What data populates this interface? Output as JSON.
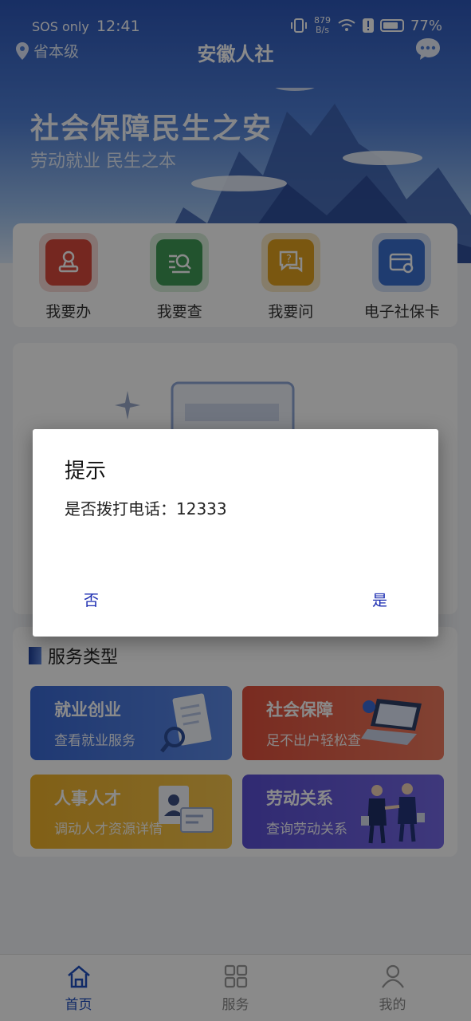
{
  "status_bar": {
    "carrier": "SOS only",
    "time": "12:41",
    "net_speed_value": "879",
    "net_speed_unit": "B/s",
    "battery": "77%"
  },
  "header": {
    "location": "省本级",
    "title": "安徽人社"
  },
  "banner": {
    "title": "社会保障民生之安",
    "subtitle": "劳动就业 民生之本"
  },
  "quick_actions": [
    {
      "label": "我要办",
      "icon": "stamp-icon",
      "color": "#d9483b"
    },
    {
      "label": "我要查",
      "icon": "search-list-icon",
      "color": "#3f9a55"
    },
    {
      "label": "我要问",
      "icon": "question-chat-icon",
      "color": "#e2a21f"
    },
    {
      "label": "电子社保卡",
      "icon": "card-icon",
      "color": "#3a6fd0"
    }
  ],
  "services": {
    "section_title": "服务类型",
    "tiles": [
      {
        "title": "就业创业",
        "subtitle": "查看就业服务",
        "color": "#3c6fd6"
      },
      {
        "title": "社会保障",
        "subtitle": "足不出户轻松查",
        "color": "#e55a45"
      },
      {
        "title": "人事人才",
        "subtitle": "调动人才资源详情",
        "color": "#f0b52a"
      },
      {
        "title": "劳动关系",
        "subtitle": "查询劳动关系",
        "color": "#6257d8"
      }
    ]
  },
  "tab_bar": [
    {
      "label": "首页",
      "active": true
    },
    {
      "label": "服务",
      "active": false
    },
    {
      "label": "我的",
      "active": false
    }
  ],
  "dialog": {
    "title": "提示",
    "message": "是否拨打电话：12333",
    "cancel_label": "否",
    "confirm_label": "是"
  }
}
